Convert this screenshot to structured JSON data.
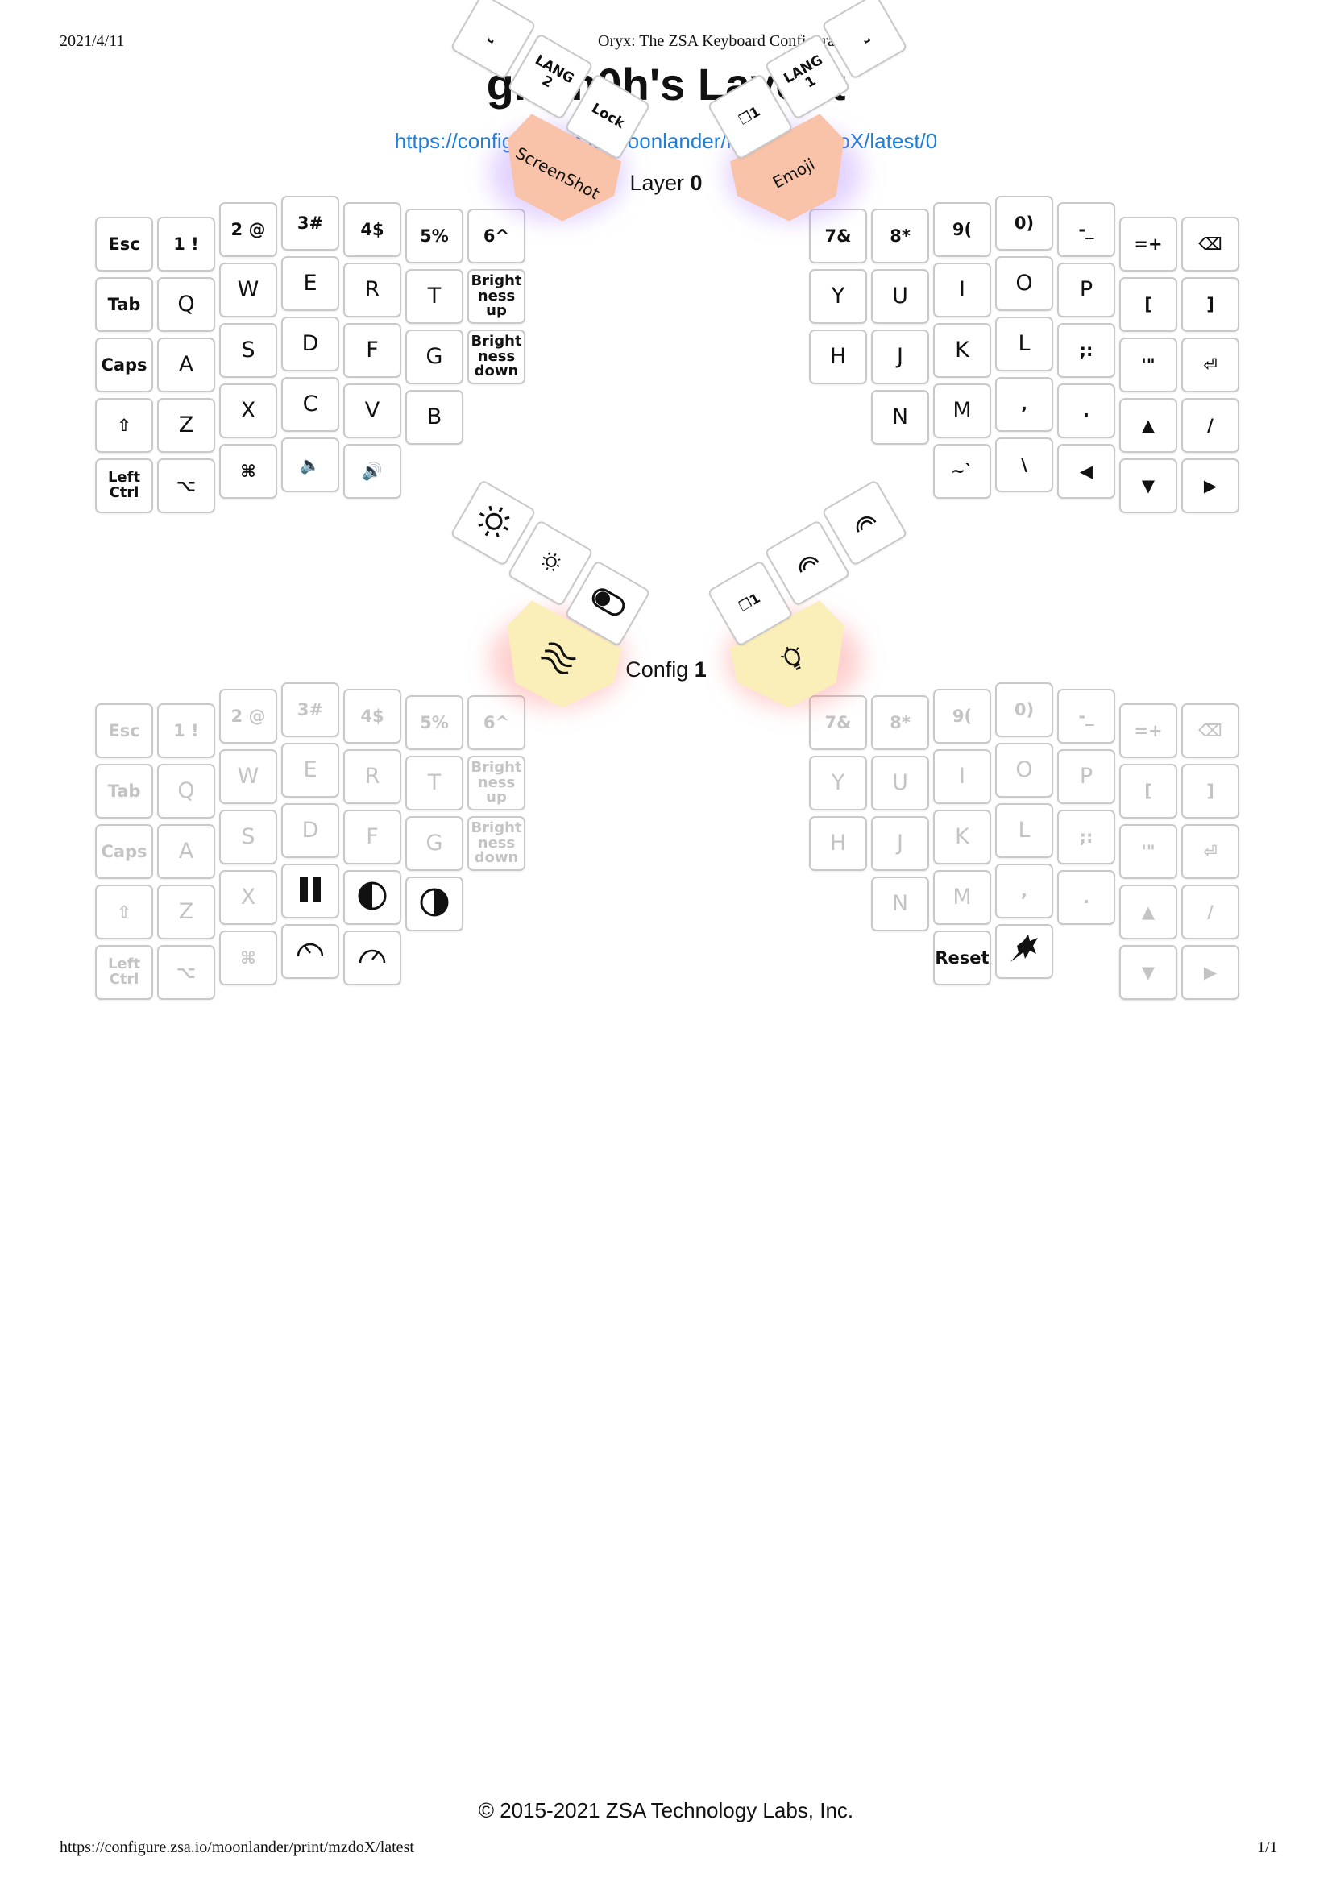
{
  "header": {
    "date": "2021/4/11",
    "app_title": "Oryx: The ZSA Keyboard Configurator"
  },
  "title": "gr1m0h's Layout",
  "layout_url": "https://configure.zsa.io/moonlander/layouts/mzdoX/latest/0",
  "layers": [
    {
      "prefix": "Layer",
      "number": "0"
    },
    {
      "prefix": "Config",
      "number": "1"
    }
  ],
  "layer0": {
    "left": {
      "row0": [
        "Esc",
        "1 !",
        "2 @",
        "3#",
        "4$",
        "5%",
        "6^"
      ],
      "row1": [
        "Tab",
        "Q",
        "W",
        "E",
        "R",
        "T",
        "Bright\nness\nup"
      ],
      "row2": [
        "Caps",
        "A",
        "S",
        "D",
        "F",
        "G",
        "Bright\nness\ndown"
      ],
      "row3": [
        "⇧",
        "Z",
        "X",
        "C",
        "V",
        "B"
      ],
      "row4": [
        "Left\nCtrl",
        "⌥",
        "⌘",
        "🔈",
        "🔊"
      ]
    },
    "right": {
      "row0": [
        "7&",
        "8*",
        "9(",
        "0)",
        "-_",
        "=+",
        "⌫"
      ],
      "row1": [
        "Y",
        "U",
        "I",
        "O",
        "P",
        "[",
        "]"
      ],
      "row2": [
        "H",
        "J",
        "K",
        "L",
        ";:",
        "'\"",
        "⏎"
      ],
      "row3": [
        "N",
        "M",
        ",",
        ".",
        "▲",
        "/"
      ],
      "row4": [
        "~`",
        "\\",
        "◀",
        "▼",
        "▶"
      ]
    },
    "thumbs": {
      "left_big": "ScreenShot",
      "left_keys": [
        "⎵",
        "LANG\n2",
        "Lock"
      ],
      "right_big": "Emoji",
      "right_keys": [
        "❐1",
        "LANG\n1",
        "⎵"
      ]
    }
  },
  "layer1": {
    "left": {
      "row0": [
        "Esc",
        "1 !",
        "2 @",
        "3#",
        "4$",
        "5%",
        "6^"
      ],
      "row1": [
        "Tab",
        "Q",
        "W",
        "E",
        "R",
        "T",
        "Bright\nness\nup"
      ],
      "row2": [
        "Caps",
        "A",
        "S",
        "D",
        "F",
        "G",
        "Bright\nness\ndown"
      ],
      "row3": [
        "⇧",
        "Z",
        "X"
      ],
      "row4": [
        "Left\nCtrl",
        "⌥",
        "⌘"
      ]
    },
    "right": {
      "row0": [
        "7&",
        "8*",
        "9(",
        "0)",
        "-_",
        "=+",
        "⌫"
      ],
      "row1": [
        "Y",
        "U",
        "I",
        "O",
        "P",
        "[",
        "]"
      ],
      "row2": [
        "H",
        "J",
        "K",
        "L",
        ";:",
        "'\"",
        "⏎"
      ],
      "row3": [
        "N",
        "M",
        ",",
        ".",
        "▲",
        "/"
      ],
      "row4": [
        "Reset",
        "◀",
        "▼",
        "▶"
      ]
    },
    "thumbs": {
      "right_key": "❐1"
    }
  },
  "icons": {
    "layer1_left_row3": [
      "pause-icon",
      "contrast-left-icon",
      "contrast-right-icon"
    ],
    "layer1_left_row4": [
      "speed-down-icon",
      "speed-up-icon"
    ],
    "layer1_right_row4": [
      "zsa-logo-icon"
    ],
    "layer1_thumbs": [
      "waves-icon",
      "brightness-up-icon",
      "brightness-down-icon",
      "toggle-icon",
      "bulb-icon",
      "rainbow-icon",
      "rainbow-icon"
    ]
  },
  "footer": {
    "copyright": "© 2015-2021 ZSA Technology Labs, Inc.",
    "print_url": "https://configure.zsa.io/moonlander/print/mzdoX/latest",
    "page": "1/1"
  }
}
